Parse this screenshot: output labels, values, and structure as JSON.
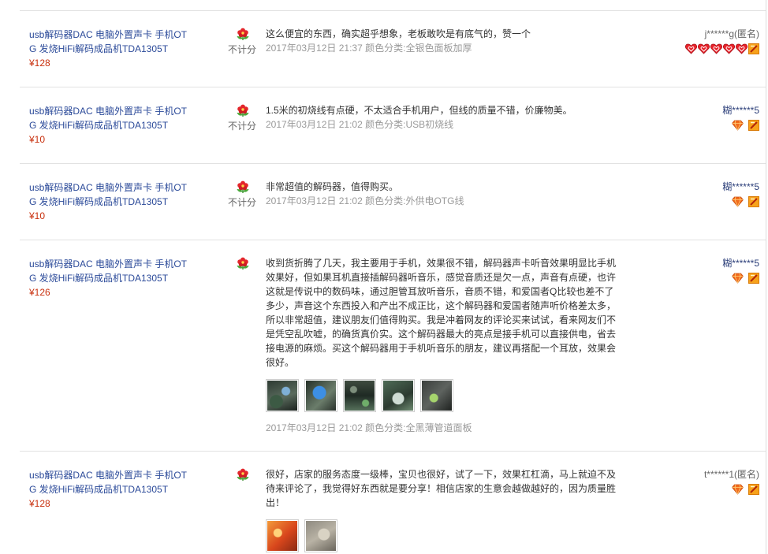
{
  "colors": {
    "link": "#2b4a99",
    "price": "#c8300e",
    "text": "#333333",
    "meta": "#999999",
    "separator": "#e2e2e2"
  },
  "reviews": [
    {
      "product": {
        "title": "usb解码器DAC 电脑外置声卡 手机OTG 发烧HiFi解码成品机TDA1305T",
        "price": "¥128"
      },
      "rating_icon": "flower-icon",
      "score_note": "不计分",
      "content": "这么便宜的东西，确实超乎想象，老板敢吹是有底气的，赞一个",
      "date": "2017年03月12日 21:37",
      "sku": "颜色分类:全银色面板加厚",
      "photo_count": 0,
      "user": {
        "name": "j******g(匿名)",
        "credit_icon": "heart-icon",
        "credit_icon_count": 5,
        "badge_icon": "vip-badge-icon"
      }
    },
    {
      "product": {
        "title": "usb解码器DAC 电脑外置声卡 手机OTG 发烧HiFi解码成品机TDA1305T",
        "price": "¥10"
      },
      "rating_icon": "flower-icon",
      "score_note": "不计分",
      "content": "1.5米的初烧线有点硬，不太适合手机用户，但线的质量不错，价廉物美。",
      "date": "2017年03月12日 21:02",
      "sku": "颜色分类:USB初烧线",
      "photo_count": 0,
      "user": {
        "name": "糊******5",
        "credit_icon": "diamond-icon",
        "credit_icon_count": 1,
        "badge_icon": "vip-badge-icon"
      }
    },
    {
      "product": {
        "title": "usb解码器DAC 电脑外置声卡 手机OTG 发烧HiFi解码成品机TDA1305T",
        "price": "¥10"
      },
      "rating_icon": "flower-icon",
      "score_note": "不计分",
      "content": "非常超值的解码器，值得购买。",
      "date": "2017年03月12日 21:02",
      "sku": "颜色分类:外供电OTG线",
      "photo_count": 0,
      "user": {
        "name": "糊******5",
        "credit_icon": "diamond-icon",
        "credit_icon_count": 1,
        "badge_icon": "vip-badge-icon"
      }
    },
    {
      "product": {
        "title": "usb解码器DAC 电脑外置声卡 手机OTG 发烧HiFi解码成品机TDA1305T",
        "price": "¥126"
      },
      "rating_icon": "flower-icon",
      "content": "收到货折腾了几天，我主要用于手机，效果很不错，解码器声卡听音效果明显比手机效果好，但如果耳机直接插解码器听音乐，感觉音质还是欠一点，声音有点硬，也许这就是传说中的数码味，通过胆管耳放听音乐，音质不错，和爱国者Q比较也差不了多少，声音这个东西投入和产出不成正比，这个解码器和爱国者随声听价格差太多，所以非常超值，建议朋友们值得购买。我是冲着网友的评论买来试试，看来网友们不是凭空乱吹嘘，的确货真价实。这个解码器最大的亮点是接手机可以直接供电，省去接电源的麻烦。买这个解码器用于手机听音乐的朋友，建议再搭配一个耳放，效果会很好。",
      "date": "2017年03月12日 21:02",
      "sku": "颜色分类:全黑薄管道面板",
      "photo_count": 5,
      "user": {
        "name": "糊******5",
        "credit_icon": "diamond-icon",
        "credit_icon_count": 1,
        "badge_icon": "vip-badge-icon"
      }
    },
    {
      "product": {
        "title": "usb解码器DAC 电脑外置声卡 手机OTG 发烧HiFi解码成品机TDA1305T",
        "price": "¥128"
      },
      "rating_icon": "flower-icon",
      "content": "很好，店家的服务态度一级棒，宝贝也很好，试了一下，效果杠杠滴，马上就迫不及待来评论了，我觉得好东西就是要分享！相信店家的生意会越做越好的，因为质量胜出！",
      "photo_count": 2,
      "user": {
        "name": "t******1(匿名)",
        "credit_icon": "diamond-icon",
        "credit_icon_count": 1,
        "badge_icon": "vip-badge-icon"
      }
    }
  ]
}
